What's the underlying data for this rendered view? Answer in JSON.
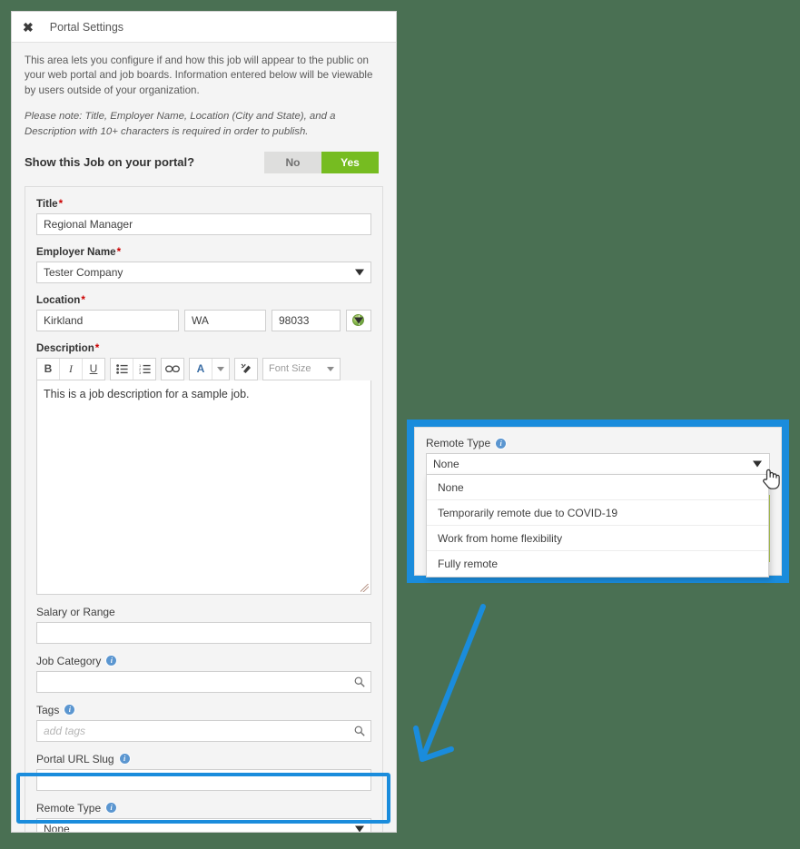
{
  "window": {
    "title": "Portal Settings",
    "close_icon": "close-x-icon"
  },
  "intro": {
    "paragraph": "This area lets you configure if and how this job will appear to the public on your web portal and job boards. Information entered below will be viewable by users outside of your organization.",
    "note": "Please note: Title, Employer Name, Location (City and State), and a Description with 10+ characters is required in order to publish."
  },
  "toggle": {
    "label": "Show this Job on your portal?",
    "no_label": "No",
    "yes_label": "Yes",
    "selected": "Yes",
    "active_color": "#76bc21",
    "inactive_color": "#dededd"
  },
  "form": {
    "title": {
      "label": "Title",
      "required": "*",
      "value": "Regional Manager"
    },
    "employer_name": {
      "label": "Employer Name",
      "required": "*",
      "value": "Tester Company"
    },
    "location": {
      "label": "Location",
      "required": "*",
      "city": "Kirkland",
      "state": "WA",
      "zip": "98033",
      "country_icon": "globe-icon"
    },
    "description": {
      "label": "Description",
      "required": "*",
      "value": "This is a job description for a sample job.",
      "toolbar": {
        "bold": "B",
        "italic": "I",
        "underline": "U",
        "bullet_list": "bullet-list-icon",
        "numbered_list": "numbered-list-icon",
        "link": "link-icon",
        "font_color": "A",
        "font_color_caret": "caret-down-icon",
        "clear_formatting": "clear-formatting-icon",
        "font_size_label": "Font Size"
      }
    },
    "salary": {
      "label": "Salary or Range",
      "value": ""
    },
    "job_category": {
      "label": "Job Category",
      "value": "",
      "info_icon": "info-icon",
      "search_icon": "search-icon"
    },
    "tags": {
      "label": "Tags",
      "value": "",
      "placeholder": "add tags",
      "info_icon": "info-icon",
      "search_icon": "search-icon"
    },
    "portal_url_slug": {
      "label": "Portal URL Slug",
      "value": "",
      "info_icon": "info-icon"
    },
    "remote_type": {
      "label": "Remote Type",
      "value": "None",
      "info_icon": "info-icon"
    }
  },
  "callout": {
    "highlight_color": "#1a8cdc",
    "remote_type": {
      "label": "Remote Type",
      "value": "None",
      "info_icon": "info-icon"
    },
    "options": [
      "None",
      "Temporarily remote due to COVID-19",
      "Work from home flexibility",
      "Fully remote"
    ],
    "cursor_icon": "pointer-hand-cursor"
  },
  "annotation": {
    "arrow_icon": "arrow-pointing-down-left",
    "arrow_color": "#1a8cdc"
  },
  "theme": {
    "background": "#4a7053",
    "panel_background": "#f4f4f4"
  }
}
